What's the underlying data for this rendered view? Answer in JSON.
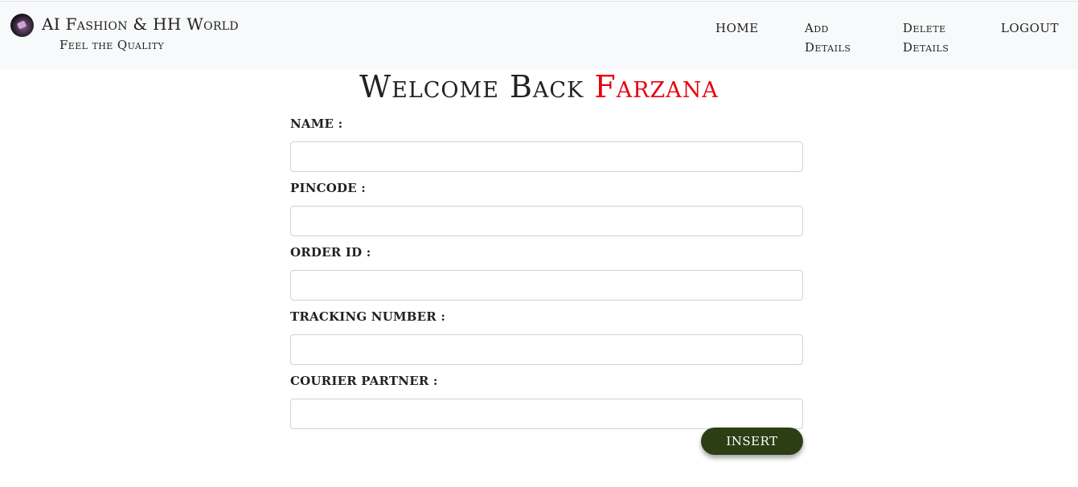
{
  "brand": {
    "title": "AI Fashion & HH World",
    "tagline": "Feel the Quality"
  },
  "nav": {
    "home": "HOME",
    "add_line1": "Add",
    "add_line2": "Details",
    "delete_line1": "Delete",
    "delete_line2": "Details",
    "logout": "LOGOUT"
  },
  "welcome": {
    "prefix": "Welcome Back",
    "name": "Farzana",
    "name_color": "#e8000f"
  },
  "form": {
    "name_label": "NAME :",
    "name_value": "",
    "pincode_label": "PINCODE :",
    "pincode_value": "",
    "order_id_label": "ORDER ID :",
    "order_id_value": "",
    "tracking_label": "TRACKING NUMBER :",
    "tracking_value": "",
    "courier_label": "COURIER PARTNER :",
    "courier_value": "",
    "insert_label": "INSERT",
    "button_color": "#2c3e13"
  }
}
